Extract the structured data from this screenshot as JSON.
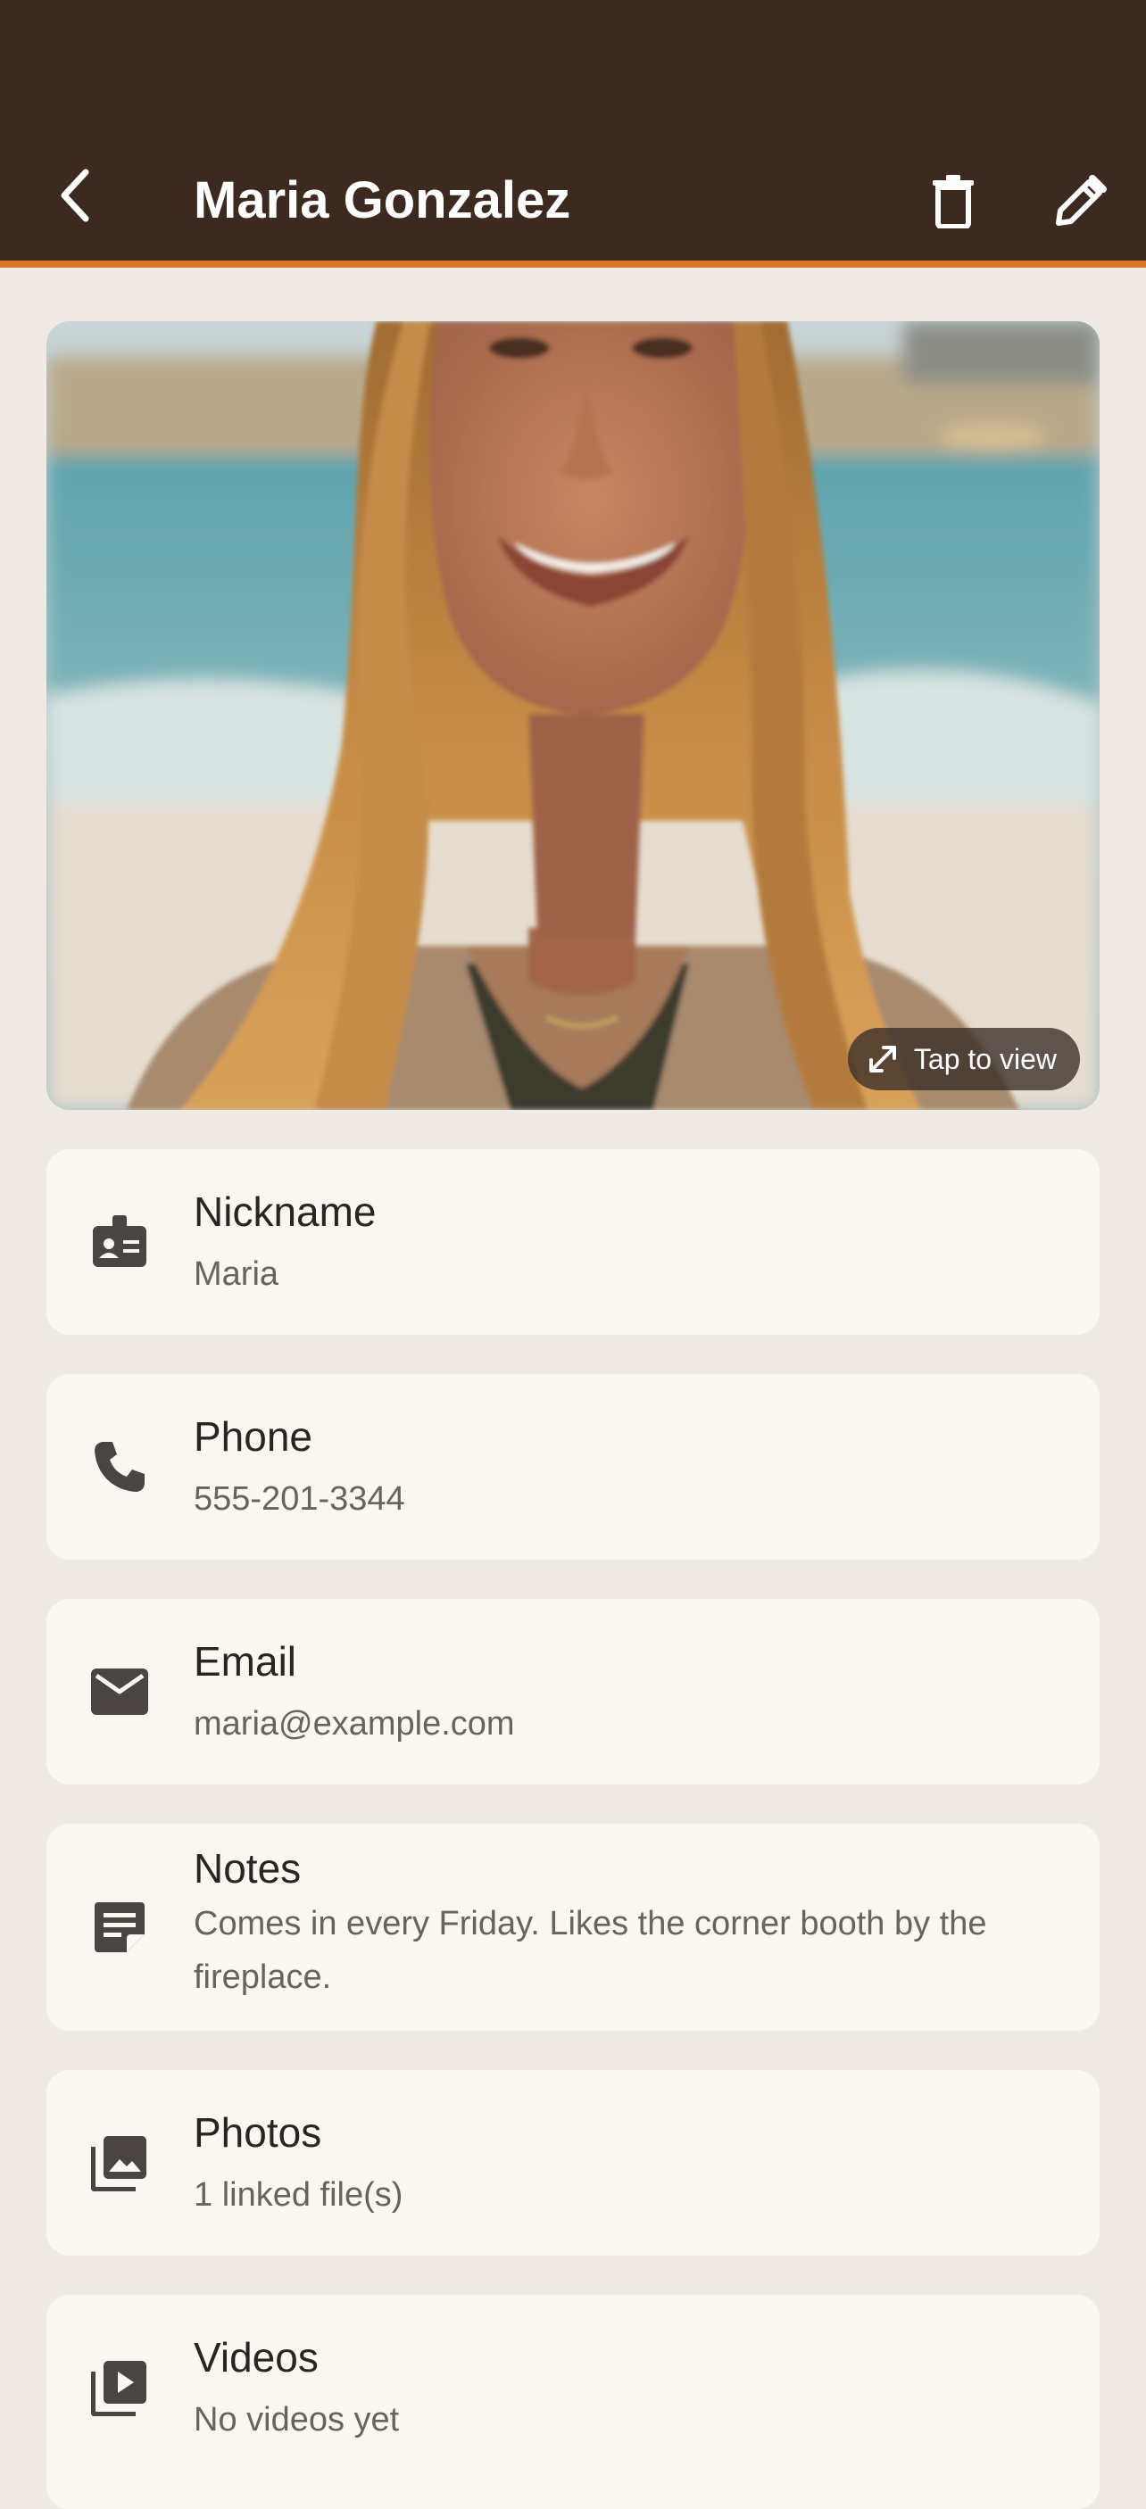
{
  "header": {
    "title": "Maria Gonzalez",
    "back_icon": "chevron-left-icon",
    "delete_icon": "trash-icon",
    "edit_icon": "pencil-icon"
  },
  "photo": {
    "view_label": "Tap to view",
    "expand_icon": "expand-icon"
  },
  "fields": {
    "nickname": {
      "label": "Nickname",
      "value": "Maria",
      "icon": "badge-icon"
    },
    "phone": {
      "label": "Phone",
      "value": "555-201-3344",
      "icon": "phone-icon"
    },
    "email": {
      "label": "Email",
      "value": "maria@example.com",
      "icon": "mail-icon"
    },
    "notes": {
      "label": "Notes",
      "value": "Comes in every Friday. Likes the corner booth by the fireplace.",
      "icon": "note-icon"
    },
    "photos": {
      "label": "Photos",
      "value": "1 linked file(s)",
      "icon": "photo-library-icon"
    },
    "videos": {
      "label": "Videos",
      "value": "No videos yet",
      "icon": "video-library-icon"
    }
  },
  "colors": {
    "app_bar": "#3c2a21",
    "accent": "#d9742b",
    "background": "#efebe4",
    "card": "#faf7f1"
  }
}
